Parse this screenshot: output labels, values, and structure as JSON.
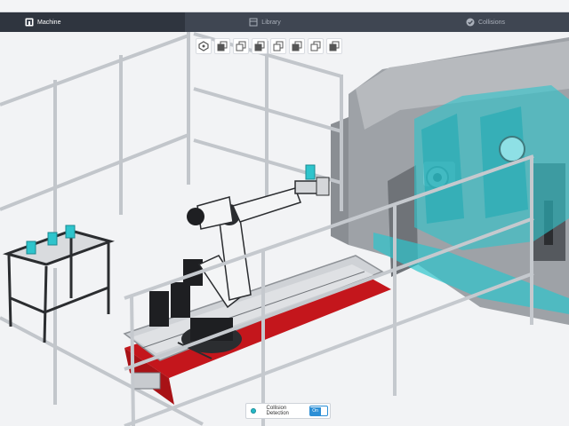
{
  "nav": {
    "tabs": [
      {
        "label": "Machine",
        "icon": "machine-icon",
        "active": true
      },
      {
        "label": "Library",
        "icon": "library-icon",
        "active": false
      },
      {
        "label": "Collisions",
        "icon": "check-circle-icon",
        "active": false
      }
    ]
  },
  "view_toolbar": {
    "buttons": [
      {
        "icon": "view-settings-icon"
      },
      {
        "icon": "cube-front-view-icon"
      },
      {
        "icon": "cube-back-view-icon"
      },
      {
        "icon": "cube-left-view-icon"
      },
      {
        "icon": "cube-right-view-icon"
      },
      {
        "icon": "cube-top-view-icon"
      },
      {
        "icon": "cube-bottom-view-icon"
      },
      {
        "icon": "cube-iso-view-icon"
      }
    ]
  },
  "collision_detection": {
    "label": "Collision Detection",
    "toggle_label": "On",
    "enabled": true
  },
  "colors": {
    "highlight": "#2ec4cc",
    "base_red": "#c4161c",
    "frame_gray": "#bfc3c8",
    "accent_blue": "#2c8fd6"
  }
}
